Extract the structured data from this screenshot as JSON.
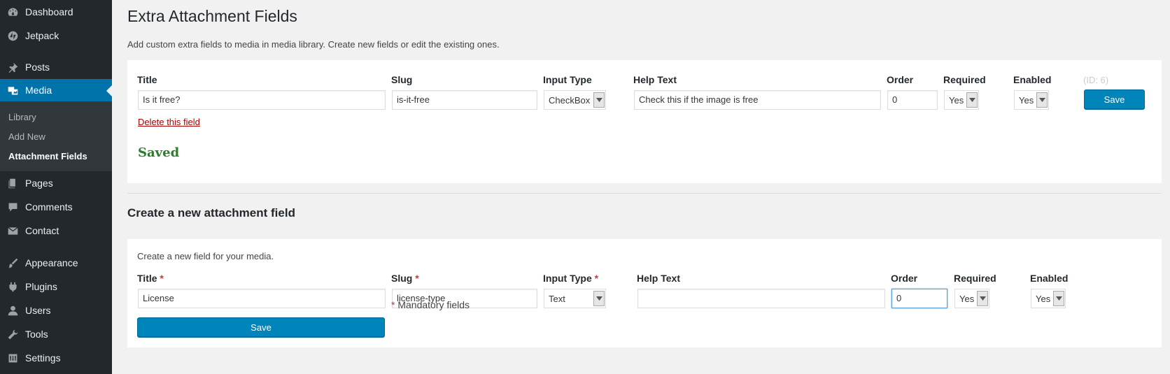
{
  "sidebar": {
    "items": [
      {
        "label": "Dashboard",
        "icon": "dashboard-icon"
      },
      {
        "label": "Jetpack",
        "icon": "jetpack-icon"
      },
      {
        "label": "Posts",
        "icon": "pin-icon"
      },
      {
        "label": "Media",
        "icon": "media-icon"
      },
      {
        "label": "Pages",
        "icon": "pages-icon"
      },
      {
        "label": "Comments",
        "icon": "comments-icon"
      },
      {
        "label": "Contact",
        "icon": "mail-icon"
      },
      {
        "label": "Appearance",
        "icon": "brush-icon"
      },
      {
        "label": "Plugins",
        "icon": "plugin-icon"
      },
      {
        "label": "Users",
        "icon": "users-icon"
      },
      {
        "label": "Tools",
        "icon": "wrench-icon"
      },
      {
        "label": "Settings",
        "icon": "settings-icon"
      }
    ],
    "submenu": [
      "Library",
      "Add New",
      "Attachment Fields"
    ]
  },
  "page": {
    "title": "Extra Attachment Fields",
    "description": "Add custom extra fields to media in media library. Create new fields or edit the existing ones."
  },
  "existing": {
    "labels": {
      "title": "Title",
      "slug": "Slug",
      "input_type": "Input Type",
      "help_text": "Help Text",
      "order": "Order",
      "required": "Required",
      "enabled": "Enabled"
    },
    "id_note": "(ID: 6)",
    "title": "Is it free?",
    "slug": "is-it-free",
    "input_type": "CheckBox",
    "help_text": "Check this if the image is free",
    "order": "0",
    "required": "Yes",
    "enabled": "Yes",
    "save_label": "Save",
    "delete_label": "Delete this field",
    "saved_message": "Saved"
  },
  "create": {
    "section_title": "Create a new attachment field",
    "description": "Create a new field for your media.",
    "labels": {
      "title": "Title",
      "slug": "Slug",
      "input_type": "Input Type",
      "help_text": "Help Text",
      "order": "Order",
      "required": "Required",
      "enabled": "Enabled"
    },
    "required_marker": "*",
    "title": "License",
    "slug": "license-type",
    "input_type": "Text",
    "help_text": "",
    "order": "0",
    "required": "Yes",
    "enabled": "Yes",
    "save_label": "Save",
    "mandatory_note": "Mandatory fields"
  },
  "colors": {
    "sidebar": "#23282d",
    "accent": "#0073aa",
    "button": "#0085ba",
    "saved": "#2a7d2a",
    "delete": "#a00"
  }
}
